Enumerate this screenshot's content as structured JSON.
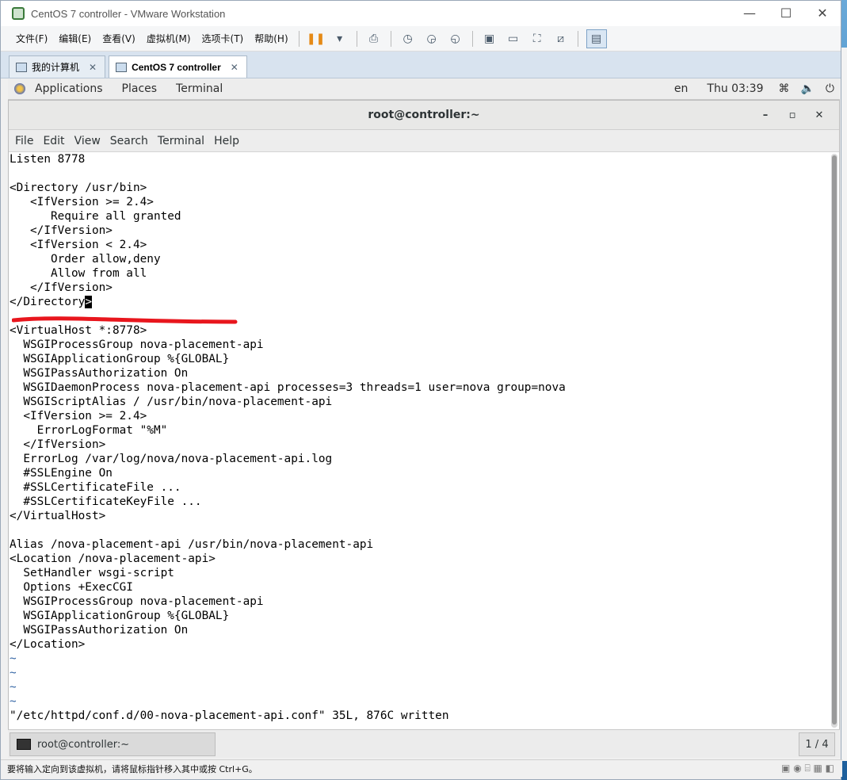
{
  "vmware": {
    "title": "CentOS 7 controller - VMware Workstation",
    "window_controls": [
      "—",
      "☐",
      "✕"
    ],
    "menu": [
      "文件(F)",
      "编辑(E)",
      "查看(V)",
      "虚拟机(M)",
      "选项卡(T)",
      "帮助(H)"
    ],
    "tabs": [
      {
        "label": "我的计算机"
      },
      {
        "label": "CentOS 7 controller"
      }
    ],
    "status_text": "要将输入定向到该虚拟机，请将鼠标指针移入其中或按 Ctrl+G。"
  },
  "gnome": {
    "applications": "Applications",
    "places": "Places",
    "terminal": "Terminal",
    "lang": "en",
    "clock": "Thu 03:39"
  },
  "terminal": {
    "title": "root@controller:~",
    "menu": [
      "File",
      "Edit",
      "View",
      "Search",
      "Terminal",
      "Help"
    ],
    "lines": [
      "Listen 8778",
      "",
      "<Directory /usr/bin>",
      "   <IfVersion >= 2.4>",
      "      Require all granted",
      "   </IfVersion>",
      "   <IfVersion < 2.4>",
      "      Order allow,deny",
      "      Allow from all",
      "   </IfVersion>",
      "</Directory",
      "",
      "<VirtualHost *:8778>",
      "  WSGIProcessGroup nova-placement-api",
      "  WSGIApplicationGroup %{GLOBAL}",
      "  WSGIPassAuthorization On",
      "  WSGIDaemonProcess nova-placement-api processes=3 threads=1 user=nova group=nova",
      "  WSGIScriptAlias / /usr/bin/nova-placement-api",
      "  <IfVersion >= 2.4>",
      "    ErrorLogFormat \"%M\"",
      "  </IfVersion>",
      "  ErrorLog /var/log/nova/nova-placement-api.log",
      "  #SSLEngine On",
      "  #SSLCertificateFile ...",
      "  #SSLCertificateKeyFile ...",
      "</VirtualHost>",
      "",
      "Alias /nova-placement-api /usr/bin/nova-placement-api",
      "<Location /nova-placement-api>",
      "  SetHandler wsgi-script",
      "  Options +ExecCGI",
      "  WSGIProcessGroup nova-placement-api",
      "  WSGIApplicationGroup %{GLOBAL}",
      "  WSGIPassAuthorization On",
      "</Location>",
      "~",
      "~",
      "~",
      "~",
      "\"/etc/httpd/conf.d/00-nova-placement-api.conf\" 35L, 876C written"
    ],
    "cursor_char": ">",
    "cursor_line": 10
  },
  "taskbar": {
    "item": "root@controller:~",
    "pager": "1 / 4"
  },
  "colors": {
    "annotation": "#e8161d",
    "tilde": "#3465a4"
  }
}
